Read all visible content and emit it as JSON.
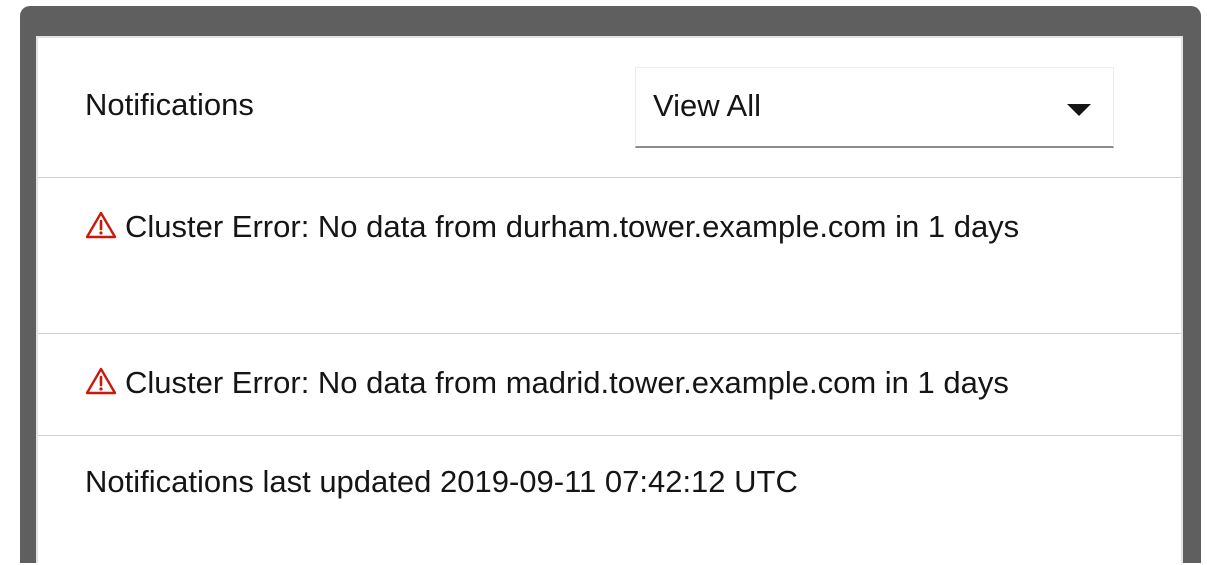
{
  "notifications": {
    "title": "Notifications",
    "filter": {
      "selected": "View All",
      "icon": "caret-down-icon"
    },
    "items": [
      {
        "icon": "warning-triangle-icon",
        "icon_color": "#c9190b",
        "text": "Cluster Error: No data from durham.tower.example.com in 1 days"
      },
      {
        "icon": "warning-triangle-icon",
        "icon_color": "#c9190b",
        "text": "Cluster Error: No data from madrid.tower.example.com in 1 days"
      }
    ],
    "last_updated": "Notifications last updated 2019-09-11 07:42:12 UTC"
  }
}
